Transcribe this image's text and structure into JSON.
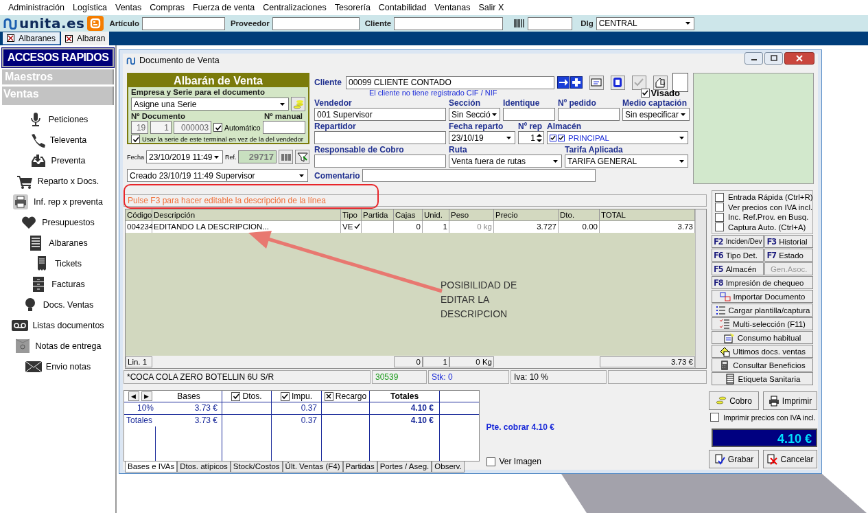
{
  "menu": [
    "Administración",
    "Logística",
    "Ventas",
    "Compras",
    "Fuerza de venta",
    "Centralizaciones",
    "Tesorería",
    "Contabilidad",
    "Ventanas",
    "Salir X"
  ],
  "toolbar": {
    "logo": "unita.es",
    "fields": [
      {
        "label": "Artículo"
      },
      {
        "label": "Proveedor"
      },
      {
        "label": "Cliente"
      }
    ],
    "dlg": {
      "label": "Dlg",
      "value": "CENTRAL"
    }
  },
  "tabs": [
    {
      "label": "Albaranes",
      "selected": false
    },
    {
      "label": "Albaran",
      "selected": true
    }
  ],
  "sidebar": {
    "title": "ACCESOS RAPIDOS",
    "sections": [
      {
        "label": "Maestros",
        "expanded": false
      },
      {
        "label": "Ventas",
        "expanded": true,
        "items": [
          "Peticiones",
          "Televenta",
          "Preventa",
          "Reparto x Docs.",
          "Inf. rep x preventa",
          "Presupuestos",
          "Albaranes",
          "Tickets",
          "Facturas",
          "Docs. Ventas",
          "Listas documentos",
          "Notas de entrega",
          "Envio notas"
        ]
      }
    ]
  },
  "window": {
    "title": "Documento de Venta"
  },
  "albaran": {
    "title": "Albarán de Venta",
    "serie_label": "Empresa y Serie para el documento",
    "serie": "Asigne una Serie",
    "doc_label": "Nº Documento",
    "manual_label": "Nº manual",
    "doc_parts": [
      "19",
      "1",
      "000003"
    ],
    "automatico": {
      "label": "Automático",
      "checked": true
    },
    "usar_serie": {
      "label": "Usar la serie de este terminal en vez de la del vendedor",
      "checked": true
    },
    "fecha_label": "Fecha",
    "fecha": "23/10/2019 11:49",
    "ref_label": "Ref.",
    "ref": "29717",
    "creado": "Creado 23/10/19 11:49 Supervisor"
  },
  "form": {
    "cliente_label": "Cliente",
    "cliente": "00099 CLIENTE CONTADO",
    "cif_warning": "El cliente no tiene registrado CIF / NIF",
    "visado": {
      "label": "Visado",
      "checked": true
    },
    "fields": [
      {
        "label": "Vendedor",
        "value": "001 Supervisor",
        "kind": "text"
      },
      {
        "label": "Sección",
        "value": "Sin Secció",
        "kind": "select"
      },
      {
        "label": "Identique",
        "kind": "text"
      },
      {
        "label": "Nº pedido",
        "kind": "text"
      },
      {
        "label": "Medio captación",
        "value": "Sin especificar",
        "kind": "select"
      },
      {
        "label": "Repartidor",
        "kind": "text"
      },
      {
        "label": "Fecha reparto",
        "value": "23/10/19",
        "kind": "select"
      },
      {
        "label": "Nº rep",
        "value": "1",
        "kind": "spin"
      },
      {
        "label": "Almacén",
        "value": "PRINCIPAL",
        "kind": "checkselect"
      },
      {
        "label": "Responsable de Cobro",
        "kind": "text"
      },
      {
        "label": "Ruta",
        "value": "Venta fuera de rutas",
        "kind": "select"
      },
      {
        "label": "Tarifa Aplicada",
        "value": "TARIFA GENERAL",
        "kind": "select"
      }
    ],
    "comentario_label": "Comentario"
  },
  "hint": "Pulse F3 para hacer editable la descripción de la línea",
  "grid": {
    "columns": [
      "Código",
      "Descripción",
      "Tipo",
      "Partida",
      "Cajas",
      "Unid.",
      "Peso",
      "Precio",
      "Dto.",
      "TOTAL"
    ],
    "rows": [
      {
        "codigo": "004234",
        "descripcion": "EDITANDO LA DESCRIPCION...",
        "tipo": "VE",
        "tipo_checked": true,
        "cajas": "0",
        "unid": "1",
        "peso": "0 kg",
        "precio": "3.727",
        "dto": "0.00",
        "total": "3.73"
      }
    ],
    "totals": {
      "codigo": "Lin. 1",
      "cajas": "0",
      "unid": "1",
      "peso": "0 Kg",
      "total": "3.73 €"
    }
  },
  "status": {
    "article": "*COCA COLA ZERO BOTELLIN 6U S/R",
    "code": "30539",
    "stock": "Stk: 0",
    "iva": "Iva: 10 %"
  },
  "annotation": {
    "note": "POSIBILIDAD DE EDITAR LA DESCRIPCION"
  },
  "options": [
    {
      "label": "Entrada Rápida (Ctrl+R)",
      "checked": false
    },
    {
      "label": "Ver precios con IVA incl.",
      "checked": false
    },
    {
      "label": "Inc. Ref.Prov. en Busq.",
      "checked": false
    },
    {
      "label": "Captura Auto. (Ctrl+A)",
      "checked": false
    }
  ],
  "fkeys": [
    {
      "key": "F2",
      "label": "Inciden/Dev",
      "disabled": false
    },
    {
      "key": "F3",
      "label": "Historial",
      "disabled": false
    },
    {
      "key": "F6",
      "label": "Tipo Det.",
      "disabled": false
    },
    {
      "key": "F7",
      "label": "Estado",
      "disabled": false
    },
    {
      "key": "F5",
      "label": "Almacén",
      "disabled": false
    },
    {
      "label": "Gen.Asoc.",
      "disabled": true
    },
    {
      "key": "F8",
      "label": "Impresión de chequeo",
      "disabled": false
    }
  ],
  "actions": [
    "Importar Documento",
    "Cargar plantilla/captura",
    "Multi-selección (F11)",
    "Consumo habitual",
    "Ultimos docs. ventas",
    "Consultar Beneficios",
    "Etiqueta Sanitaria"
  ],
  "taxes": {
    "nav": [
      "◀",
      "▶"
    ],
    "columns": [
      {
        "label": "Bases",
        "kind": "plain"
      },
      {
        "label": "Dtos.",
        "kind": "tick",
        "checked": true
      },
      {
        "label": "Impu.",
        "kind": "tick",
        "checked": true
      },
      {
        "label": "Recargo",
        "kind": "cross",
        "checked": true
      },
      {
        "label": "Totales",
        "kind": "bold"
      }
    ],
    "rows": [
      {
        "label": "10%",
        "bases": "3.73 €",
        "impu": "0.37",
        "totales": "4.10 €"
      },
      {
        "label": "Totales",
        "bases": "3.73 €",
        "impu": "0.37",
        "totales": "4.10 €"
      }
    ]
  },
  "bottom_tabs": [
    {
      "label": "Bases e IVAs",
      "selected": true
    },
    {
      "label": "Dtos. atípicos",
      "selected": false
    },
    {
      "label": "Stock/Costos",
      "selected": false
    },
    {
      "label": "Últ. Ventas (F4)",
      "selected": false
    },
    {
      "label": "Partidas",
      "selected": false
    },
    {
      "label": "Portes / Aseg.",
      "selected": false
    },
    {
      "label": "Observ.",
      "selected": false
    }
  ],
  "pending": "Pte. cobrar 4.10 €",
  "ver_imagen": {
    "label": "Ver Imagen",
    "checked": false
  },
  "cobro": "Cobro",
  "imprimir": "Imprimir",
  "iva_print": {
    "label": "Imprimir precios con IVA incl.",
    "checked": false
  },
  "total": "4.10 €",
  "grabar": "Grabar",
  "cancelar": "Cancelar"
}
